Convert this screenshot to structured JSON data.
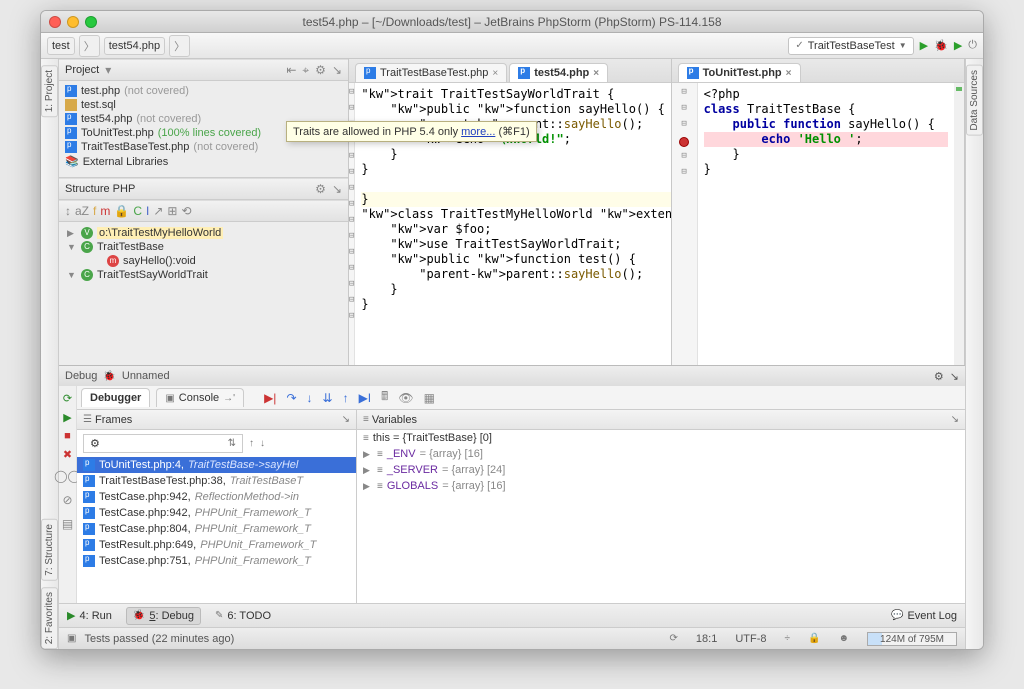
{
  "window_title": "test54.php – [~/Downloads/test] – JetBrains PhpStorm (PhpStorm) PS-114.158",
  "breadcrumb": {
    "root": "test",
    "file": "test54.php"
  },
  "run_config": "TraitTestBaseTest",
  "left_rail": {
    "project": "1: Project",
    "structure": "7: Structure",
    "favorites": "2: Favorites"
  },
  "right_rail": {
    "data": "Data Sources"
  },
  "project_panel": {
    "title": "Project",
    "files": [
      {
        "name": "test.php",
        "note": "(not covered)",
        "type": "php"
      },
      {
        "name": "test.sql",
        "note": "",
        "type": "sql"
      },
      {
        "name": "test54.php",
        "note": "(not covered)",
        "type": "php"
      },
      {
        "name": "ToUnitTest.php",
        "note": "(100% lines covered)",
        "type": "php",
        "green": true
      },
      {
        "name": "TraitTestBaseTest.php",
        "note": "(not covered)",
        "type": "php"
      },
      {
        "name": "External Libraries",
        "note": "",
        "type": "lib"
      }
    ]
  },
  "tooltip": {
    "text": "Traits are allowed in PHP 5.4 only ",
    "link": "more...",
    "key": "(⌘F1)"
  },
  "structure_panel": {
    "title": "Structure PHP",
    "items": [
      {
        "kind": "obj",
        "label": "o:\\TraitTestMyHelloWorld",
        "sel": true
      },
      {
        "kind": "class",
        "label": "TraitTestBase",
        "expanded": true
      },
      {
        "kind": "method",
        "label": "sayHello():void",
        "indent": true
      },
      {
        "kind": "trait",
        "label": "TraitTestSayWorldTrait",
        "expanded": true
      }
    ]
  },
  "editor_left": {
    "tabs": [
      {
        "label": "TraitTestBaseTest.php",
        "active": false
      },
      {
        "label": "test54.php",
        "active": true
      }
    ],
    "code_lines": [
      "trait TraitTestSayWorldTrait {",
      "    public function sayHello() {",
      "        parent::sayHello();",
      "        echo \"\\nWorld!\";",
      "    }",
      "}",
      "",
      "",
      "class TraitTestMyHelloWorld extends Trai",
      "    var $foo;",
      "    use TraitTestSayWorldTrait;",
      "    public function test() {",
      "        parent::sayHello();",
      "    }",
      "}"
    ]
  },
  "editor_right": {
    "tabs": [
      {
        "label": "ToUnitTest.php",
        "active": true
      }
    ],
    "code_lines": [
      "<?php",
      "class TraitTestBase {",
      "    public function sayHello() {",
      "        echo 'Hello ';",
      "    }",
      "}"
    ],
    "breakpoint_line": 4
  },
  "debug": {
    "header": "Debug",
    "session": "Unnamed",
    "tabs": {
      "debugger": "Debugger",
      "console": "Console"
    },
    "frames_title": "Frames",
    "vars_title": "Variables",
    "thread_icon": "⚙",
    "frames": [
      {
        "file": "ToUnitTest.php:4",
        "meta": "TraitTestBase->sayHel",
        "sel": true
      },
      {
        "file": "TraitTestBaseTest.php:38",
        "meta": "TraitTestBaseT"
      },
      {
        "file": "TestCase.php:942",
        "meta": "ReflectionMethod->in"
      },
      {
        "file": "TestCase.php:942",
        "meta": "PHPUnit_Framework_T"
      },
      {
        "file": "TestCase.php:804",
        "meta": "PHPUnit_Framework_T"
      },
      {
        "file": "TestResult.php:649",
        "meta": "PHPUnit_Framework_T"
      },
      {
        "file": "TestCase.php:751",
        "meta": "PHPUnit_Framework_T"
      }
    ],
    "this_var": "this = {TraitTestBase} [0]",
    "vars": [
      {
        "name": "_ENV",
        "val": "= {array} [16]"
      },
      {
        "name": "_SERVER",
        "val": "= {array} [24]"
      },
      {
        "name": "GLOBALS",
        "val": "= {array} [16]"
      }
    ]
  },
  "bottom": {
    "run": "4: Run",
    "debug": "5: Debug",
    "todo": "6: TODO",
    "eventlog": "Event Log"
  },
  "status": {
    "msg": "Tests passed (22 minutes ago)",
    "pos": "18:1",
    "enc": "UTF-8",
    "mem": "124M of 795M"
  }
}
